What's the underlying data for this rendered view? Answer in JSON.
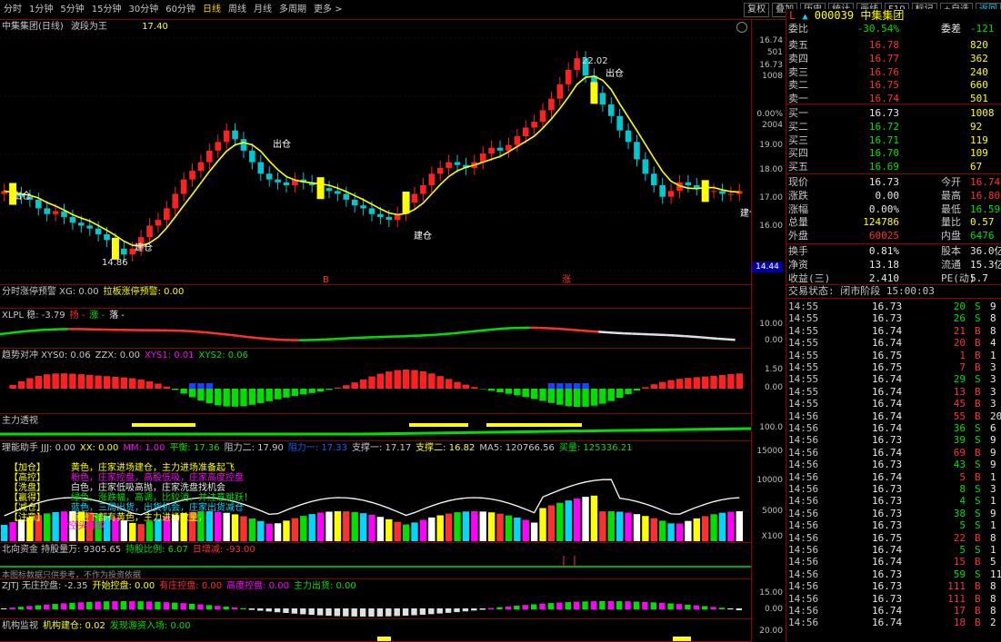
{
  "toolbar": {
    "timeframes": [
      "分时",
      "1分钟",
      "5分钟",
      "15分钟",
      "30分钟",
      "60分钟",
      "日线",
      "周线",
      "月线",
      "多周期",
      "更多 >"
    ],
    "active_timeframe": "日线",
    "tools": [
      "复权",
      "叠加",
      "历史",
      "统计",
      "画线",
      "F10",
      "标记",
      "+自选",
      "返回"
    ],
    "active_tool": "返回"
  },
  "main_panel": {
    "title_stock": "中集集团(日线)",
    "title_indicator": "波段为王",
    "title_value": "17.40",
    "high_label": "22.02",
    "low_label": "14.86",
    "signals": [
      "出仓",
      "出仓",
      "建仓",
      "建仓",
      "出仓",
      "建仓"
    ],
    "markers": [
      "B",
      "涨"
    ],
    "axis": [
      "16.74",
      "501",
      "16.73",
      "1008",
      "0.00%",
      "2004",
      "19.00",
      "18.00",
      "17.00",
      "16.00"
    ],
    "price_box": "14.44"
  },
  "panels": [
    {
      "name": "分时涨停预警",
      "items": [
        {
          "label": "分时涨停预警 XG: 0.00",
          "color": "#c8c8c8"
        },
        {
          "label": "拉板涨停预警: 0.00",
          "color": "#ffff00"
        }
      ],
      "axis": []
    },
    {
      "name": "XLPL",
      "items": [
        {
          "label": "XLPL 稳: -3.79",
          "color": "#c8c8c8"
        },
        {
          "label": "扬 -",
          "color": "#ff3030"
        },
        {
          "label": "涨 -",
          "color": "#00e000"
        },
        {
          "label": "落 -",
          "color": "#e8e8e8"
        }
      ],
      "axis": [
        "10.00",
        "0.00"
      ]
    },
    {
      "name": "趋势对冲",
      "items": [
        {
          "label": "趋势对冲 XYS0: 0.06",
          "color": "#c8c8c8"
        },
        {
          "label": "ZZX: 0.00",
          "color": "#c8c8c8"
        },
        {
          "label": "XYS1: 0.01",
          "color": "#ff00ff"
        },
        {
          "label": "XYS2: 0.06",
          "color": "#00e000"
        }
      ],
      "axis": [
        "1.50",
        "0.00"
      ]
    },
    {
      "name": "主力透视",
      "items": [
        {
          "label": "主力透视",
          "color": "#c8c8c8"
        }
      ],
      "axis": [
        "100.0"
      ]
    },
    {
      "name": "理能助手",
      "items": [
        {
          "label": "理能助手 JJJ: 0.00",
          "color": "#c8c8c8"
        },
        {
          "label": "XX: 0.00",
          "color": "#ffff00"
        },
        {
          "label": "MM: 1.00",
          "color": "#ff00ff"
        },
        {
          "label": "平衡: 17.36",
          "color": "#00e000"
        },
        {
          "label": "阻力二: 17.90",
          "color": "#c8c8c8"
        },
        {
          "label": "阻力一: 17.33",
          "color": "#0060ff"
        },
        {
          "label": "支撑一: 17.17",
          "color": "#c8c8c8"
        },
        {
          "label": "支撑二: 16.82",
          "color": "#ffff00"
        },
        {
          "label": "MA5: 120766.56",
          "color": "#c8c8c8"
        },
        {
          "label": "买量: 125336.21",
          "color": "#00e000"
        }
      ],
      "axis": [
        "15000",
        "10000",
        "5000",
        "X100"
      ]
    },
    {
      "name": "北向资金",
      "items": [
        {
          "label": "北向资金 持股量万: 9305.65",
          "color": "#c8c8c8"
        },
        {
          "label": "持股比例: 6.07",
          "color": "#00e000"
        },
        {
          "label": "日增减: -93.00",
          "color": "#ff3030"
        }
      ],
      "axis": []
    },
    {
      "name": "ZJTJ",
      "items": [
        {
          "label": "ZJTJ 无庄控盘: -2.35",
          "color": "#c8c8c8"
        },
        {
          "label": "开始控盘: 0.00",
          "color": "#ffff00"
        },
        {
          "label": "有庄控盘: 0.00",
          "color": "#ff3030"
        },
        {
          "label": "高度控盘: 0.00",
          "color": "#ff00ff"
        },
        {
          "label": "主力出货: 0.00",
          "color": "#00e000"
        }
      ],
      "axis": [
        "15.00",
        "0.00"
      ]
    },
    {
      "name": "机构监视",
      "items": [
        {
          "label": "机构监视",
          "color": "#c8c8c8"
        },
        {
          "label": "机构建仓: 0.02",
          "color": "#ffff00"
        },
        {
          "label": "发现游资入场: 0.00",
          "color": "#00e000"
        }
      ],
      "axis": [
        "20.00"
      ]
    }
  ],
  "legend": [
    {
      "tag": "【加仓】",
      "text": "黄色，庄家进场建仓，主力进场准备起飞",
      "color": "#ffff00"
    },
    {
      "tag": "【高控】",
      "text": "粉色，庄家控盘，高股低吸，庄家高度控盘",
      "color": "#ff00ff"
    },
    {
      "tag": "【洗盘】",
      "text": "白色，庄家低吸高抛，庄家洗盘找机会",
      "color": "#e8e8e8"
    },
    {
      "tag": "【赢得】",
      "text": "绿色，涨跌幅，高调，比较消，并注意跳跃！",
      "color": "#00e000"
    },
    {
      "tag": "【减仓】",
      "text": "蓝色，三周出货，出货机会，庄家出货减仓",
      "color": "#00d7ff"
    },
    {
      "tag": "【注意】",
      "text": "画量下部有黄色，主力进场放量，",
      "color": "#ffff00"
    }
  ],
  "legend_note": "▼空头释放",
  "north_note": "本图标数据只供参考，不作为投资依据",
  "quote": {
    "code": "000039",
    "name": "中集集团",
    "weibi_label": "委比",
    "weibi": "-30.54%",
    "weicha_label": "委差",
    "weicha": "-121",
    "asks": [
      {
        "label": "卖五",
        "price": "16.78",
        "vol": "820"
      },
      {
        "label": "卖四",
        "price": "16.77",
        "vol": "362"
      },
      {
        "label": "卖三",
        "price": "16.76",
        "vol": "240"
      },
      {
        "label": "卖二",
        "price": "16.75",
        "vol": "660"
      },
      {
        "label": "卖一",
        "price": "16.74",
        "vol": "501"
      }
    ],
    "bids": [
      {
        "label": "买一",
        "price": "16.73",
        "vol": "1008"
      },
      {
        "label": "买二",
        "price": "16.72",
        "vol": "92"
      },
      {
        "label": "买三",
        "price": "16.71",
        "vol": "119"
      },
      {
        "label": "买四",
        "price": "16.70",
        "vol": "109"
      },
      {
        "label": "买五",
        "price": "16.69",
        "vol": "67"
      }
    ],
    "stats": [
      {
        "l1": "现价",
        "v1": "16.73",
        "c1": "white",
        "l2": "今开",
        "v2": "16.74",
        "c2": "red"
      },
      {
        "l1": "涨跌",
        "v1": "0.00",
        "c1": "white",
        "l2": "最高",
        "v2": "16.80",
        "c2": "red"
      },
      {
        "l1": "涨幅",
        "v1": "0.00%",
        "c1": "white",
        "l2": "最低",
        "v2": "16.59",
        "c2": "green"
      },
      {
        "l1": "总量",
        "v1": "124786",
        "c1": "yellow",
        "l2": "量比",
        "v2": "0.57",
        "c2": "yellow"
      },
      {
        "l1": "外盘",
        "v1": "60025",
        "c1": "red",
        "l2": "内盘",
        "v2": "6476",
        "c2": "green"
      }
    ],
    "stats2": [
      {
        "l1": "换手",
        "v1": "0.81%",
        "l2": "股本",
        "v2": "36.0亿"
      },
      {
        "l1": "净资",
        "v1": "13.18",
        "l2": "流通",
        "v2": "15.3亿"
      },
      {
        "l1": "收益(三)",
        "v1": "2.410",
        "l2": "PE(动)",
        "v2": "5.7"
      }
    ],
    "status": "交易状态: 闭市阶段 15:00:03",
    "ticks": [
      {
        "t": "14:55",
        "p": "16.73",
        "v": "20",
        "d": "S",
        "dc": "green",
        "e": "9"
      },
      {
        "t": "14:55",
        "p": "16.73",
        "v": "26",
        "d": "S",
        "dc": "green",
        "e": "8"
      },
      {
        "t": "14:55",
        "p": "16.74",
        "v": "21",
        "d": "B",
        "dc": "red",
        "e": "8"
      },
      {
        "t": "14:55",
        "p": "16.74",
        "v": "20",
        "d": "B",
        "dc": "red",
        "e": "4"
      },
      {
        "t": "14:55",
        "p": "16.75",
        "v": "1",
        "d": "B",
        "dc": "red",
        "e": "1"
      },
      {
        "t": "14:55",
        "p": "16.75",
        "v": "7",
        "d": "B",
        "dc": "red",
        "e": "3"
      },
      {
        "t": "14:55",
        "p": "16.74",
        "v": "29",
        "d": "S",
        "dc": "green",
        "e": "3"
      },
      {
        "t": "14:55",
        "p": "16.74",
        "v": "13",
        "d": "B",
        "dc": "red",
        "e": "3"
      },
      {
        "t": "14:55",
        "p": "16.74",
        "v": "45",
        "d": "B",
        "dc": "red",
        "e": "3"
      },
      {
        "t": "14:56",
        "p": "16.74",
        "v": "55",
        "d": "B",
        "dc": "red",
        "e": "20"
      },
      {
        "t": "14:56",
        "p": "16.74",
        "v": "36",
        "d": "S",
        "dc": "green",
        "e": "6"
      },
      {
        "t": "14:56",
        "p": "16.73",
        "v": "39",
        "d": "S",
        "dc": "green",
        "e": "9"
      },
      {
        "t": "14:56",
        "p": "16.74",
        "v": "69",
        "d": "B",
        "dc": "red",
        "e": "9"
      },
      {
        "t": "14:56",
        "p": "16.73",
        "v": "43",
        "d": "S",
        "dc": "green",
        "e": "9"
      },
      {
        "t": "14:56",
        "p": "16.74",
        "v": "5",
        "d": "B",
        "dc": "red",
        "e": "1"
      },
      {
        "t": "14:56",
        "p": "16.73",
        "v": "8",
        "d": "S",
        "dc": "green",
        "e": "3"
      },
      {
        "t": "14:56",
        "p": "16.73",
        "v": "4",
        "d": "S",
        "dc": "green",
        "e": "1"
      },
      {
        "t": "14:56",
        "p": "16.73",
        "v": "38",
        "d": "S",
        "dc": "green",
        "e": "9"
      },
      {
        "t": "14:56",
        "p": "16.73",
        "v": "5",
        "d": "S",
        "dc": "green",
        "e": "1"
      },
      {
        "t": "14:56",
        "p": "16.75",
        "v": "22",
        "d": "B",
        "dc": "red",
        "e": "8"
      },
      {
        "t": "14:56",
        "p": "16.74",
        "v": "5",
        "d": "S",
        "dc": "green",
        "e": "1"
      },
      {
        "t": "14:56",
        "p": "16.74",
        "v": "15",
        "d": "B",
        "dc": "red",
        "e": "5"
      },
      {
        "t": "14:56",
        "p": "16.73",
        "v": "59",
        "d": "S",
        "dc": "green",
        "e": "11"
      },
      {
        "t": "14:56",
        "p": "16.73",
        "v": "111",
        "d": "B",
        "dc": "red",
        "e": "8"
      },
      {
        "t": "14:56",
        "p": "16.73",
        "v": "111",
        "d": "B",
        "dc": "red",
        "e": "8"
      },
      {
        "t": "14:56",
        "p": "16.74",
        "v": "17",
        "d": "B",
        "dc": "red",
        "e": "8"
      },
      {
        "t": "14:56",
        "p": "16.74",
        "v": "18",
        "d": "B",
        "dc": "red",
        "e": "2"
      }
    ]
  },
  "chart_data": {
    "type": "candlestick",
    "title": "中集集团(日线)",
    "series": [
      {
        "name": "波段为王",
        "last": 17.4
      }
    ],
    "ylim": [
      14.44,
      22.5
    ],
    "annotated_high": 22.02,
    "annotated_low": 14.86,
    "closes": [
      17.2,
      17.1,
      17.0,
      16.9,
      16.6,
      16.4,
      16.5,
      16.3,
      16.1,
      16.0,
      15.9,
      15.7,
      15.5,
      15.2,
      15.0,
      15.2,
      15.6,
      16.0,
      16.2,
      16.6,
      17.1,
      17.6,
      17.9,
      18.2,
      18.6,
      18.9,
      19.3,
      19.0,
      18.6,
      18.2,
      17.8,
      17.6,
      17.5,
      17.4,
      17.6,
      17.5,
      17.4,
      17.3,
      17.2,
      17.1,
      16.9,
      16.7,
      16.6,
      16.4,
      16.3,
      16.2,
      16.4,
      16.8,
      17.1,
      17.4,
      17.8,
      18.0,
      18.2,
      18.1,
      18.0,
      18.2,
      18.5,
      18.7,
      18.6,
      18.8,
      19.1,
      19.4,
      19.6,
      20.0,
      20.4,
      20.9,
      21.4,
      21.8,
      21.2,
      20.6,
      20.2,
      19.8,
      19.3,
      18.9,
      18.3,
      17.8,
      17.4,
      17.0,
      17.2,
      17.5,
      17.4,
      17.3,
      17.2,
      17.2,
      17.1,
      17.1,
      17.2
    ]
  }
}
